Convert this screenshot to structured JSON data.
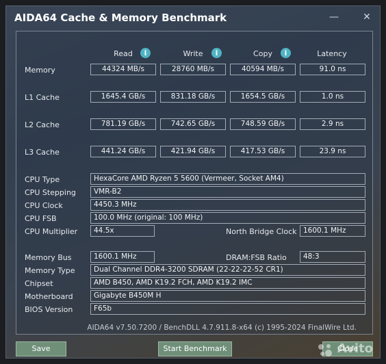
{
  "window": {
    "title": "AIDA64 Cache & Memory Benchmark"
  },
  "headers": {
    "read": "Read",
    "write": "Write",
    "copy": "Copy",
    "latency": "Latency"
  },
  "bench_rows": [
    {
      "label": "Memory",
      "read": "44324 MB/s",
      "write": "28760 MB/s",
      "copy": "40594 MB/s",
      "latency": "91.0 ns"
    },
    {
      "label": "L1 Cache",
      "read": "1645.4 GB/s",
      "write": "831.18 GB/s",
      "copy": "1654.5 GB/s",
      "latency": "1.0 ns"
    },
    {
      "label": "L2 Cache",
      "read": "781.19 GB/s",
      "write": "742.65 GB/s",
      "copy": "748.59 GB/s",
      "latency": "2.9 ns"
    },
    {
      "label": "L3 Cache",
      "read": "441.24 GB/s",
      "write": "421.94 GB/s",
      "copy": "417.53 GB/s",
      "latency": "23.9 ns"
    }
  ],
  "cpu": {
    "type_label": "CPU Type",
    "type_value": "HexaCore AMD Ryzen 5 5600  (Vermeer, Socket AM4)",
    "stepping_label": "CPU Stepping",
    "stepping_value": "VMR-B2",
    "clock_label": "CPU Clock",
    "clock_value": "4450.3 MHz",
    "fsb_label": "CPU FSB",
    "fsb_value": "100.0 MHz  (original: 100 MHz)",
    "mult_label": "CPU Multiplier",
    "mult_value": "44.5x",
    "nb_label": "North Bridge Clock",
    "nb_value": "1600.1 MHz"
  },
  "system": {
    "membus_label": "Memory Bus",
    "membus_value": "1600.1 MHz",
    "dram_label": "DRAM:FSB Ratio",
    "dram_value": "48:3",
    "memtype_label": "Memory Type",
    "memtype_value": "Dual Channel DDR4-3200 SDRAM  (22-22-22-52 CR1)",
    "chipset_label": "Chipset",
    "chipset_value": "AMD B450, AMD K19.2 FCH, AMD K19.2 IMC",
    "mobo_label": "Motherboard",
    "mobo_value": "Gigabyte B450M H",
    "bios_label": "BIOS Version",
    "bios_value": "F65b"
  },
  "footer": "AIDA64 v7.50.7200 / BenchDLL 4.7.911.8-x64  (c) 1995-2024 FinalWire Ltd.",
  "buttons": {
    "save": "Save",
    "start": "Start Benchmark",
    "close": "Close"
  },
  "watermark": "Avito",
  "icons": {
    "info": "info-icon",
    "minimize": "minimize-icon",
    "close": "close-icon"
  },
  "colors": {
    "accent_button": "#6f8f79",
    "info_icon": "#4fb3c4"
  }
}
